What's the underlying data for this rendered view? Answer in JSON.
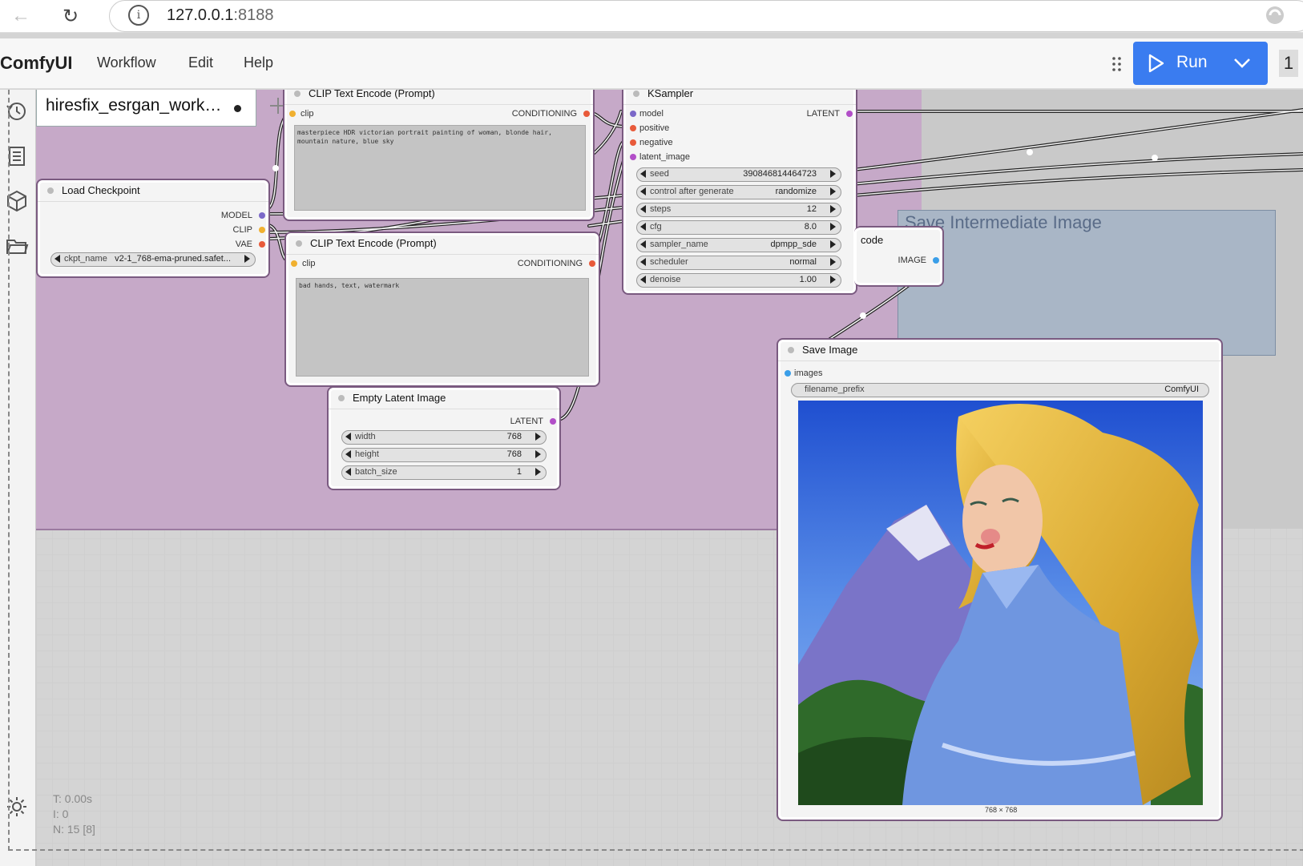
{
  "browser": {
    "back_glyph": "←",
    "reload_glyph": "↻",
    "info_glyph": "i",
    "url_host": "127.0.0.1",
    "url_port": ":8188"
  },
  "app": {
    "logo": "ComfyUI",
    "menu": [
      "Workflow",
      "Edit",
      "Help"
    ],
    "run_label": "Run",
    "queue_count": "1",
    "accent_color": "#3a7cf0"
  },
  "tab": {
    "name": "hiresfix_esrgan_work…"
  },
  "sidebar_icons": [
    "history-icon",
    "queue-icon",
    "model-library-icon",
    "workflows-icon",
    "settings-icon"
  ],
  "groups": {
    "save_intermediate_title": "Save Intermediate Image"
  },
  "nodes": {
    "load_checkpoint": {
      "title": "Load Checkpoint",
      "outputs": [
        "MODEL",
        "CLIP",
        "VAE"
      ],
      "ckpt_label": "ckpt_name",
      "ckpt_value": "v2-1_768-ema-pruned.safet..."
    },
    "clip_pos": {
      "title": "CLIP Text Encode (Prompt)",
      "input": "clip",
      "output": "CONDITIONING",
      "text": "masterpiece HDR victorian portrait painting of woman, blonde hair, mountain nature, blue sky"
    },
    "clip_neg": {
      "title": "CLIP Text Encode (Prompt)",
      "input": "clip",
      "output": "CONDITIONING",
      "text": "bad hands, text, watermark"
    },
    "ksampler": {
      "title": "KSampler",
      "inputs": [
        "model",
        "positive",
        "negative",
        "latent_image"
      ],
      "output": "LATENT",
      "widgets": [
        {
          "label": "seed",
          "value": "390846814464723"
        },
        {
          "label": "control after generate",
          "value": "randomize"
        },
        {
          "label": "steps",
          "value": "12"
        },
        {
          "label": "cfg",
          "value": "8.0"
        },
        {
          "label": "sampler_name",
          "value": "dpmpp_sde"
        },
        {
          "label": "scheduler",
          "value": "normal"
        },
        {
          "label": "denoise",
          "value": "1.00"
        }
      ]
    },
    "vae_decode": {
      "title_fragment": "code",
      "output": "IMAGE"
    },
    "empty_latent": {
      "title": "Empty Latent Image",
      "output": "LATENT",
      "widgets": [
        {
          "label": "width",
          "value": "768"
        },
        {
          "label": "height",
          "value": "768"
        },
        {
          "label": "batch_size",
          "value": "1"
        }
      ]
    },
    "save_image": {
      "title": "Save Image",
      "input": "images",
      "prefix_label": "filename_prefix",
      "prefix_value": "ComfyUI",
      "image_size": "768 × 768"
    }
  },
  "stats": {
    "t": "T: 0.00s",
    "i": "I: 0",
    "n": "N: 15 [8]"
  }
}
